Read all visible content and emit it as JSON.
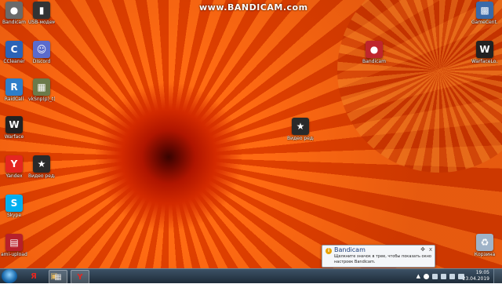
{
  "watermark": "www.BANDICAM.com",
  "desktop_icons": [
    {
      "label": "Bandicam",
      "icon": "bandicam-icon",
      "color": "#6a6a6a",
      "glyph": "●"
    },
    {
      "label": "USB-модем Билайн",
      "icon": "usb-modem-icon",
      "color": "#333333",
      "glyph": "▮"
    },
    {
      "label": "CCleaner",
      "icon": "ccleaner-icon",
      "color": "#2b63b7",
      "glyph": "C"
    },
    {
      "label": "Discord",
      "icon": "discord-icon",
      "color": "#5b6bcd",
      "glyph": "☺"
    },
    {
      "label": "RaidCall",
      "icon": "raidcall-icon",
      "color": "#2e7ec9",
      "glyph": "R"
    },
    {
      "label": "vkSnp(p)_t(c)",
      "icon": "photo-icon",
      "color": "#6c7a4a",
      "glyph": "▦"
    },
    {
      "label": "Warface",
      "icon": "warface-icon",
      "color": "#222222",
      "glyph": "W"
    },
    {
      "label": "Yandex",
      "icon": "yandex-icon",
      "color": "#e52620",
      "glyph": "Y"
    },
    {
      "label": "Видео редакт...",
      "icon": "video-editor-icon",
      "color": "#2a2a2a",
      "glyph": "★"
    },
    {
      "label": "Skype",
      "icon": "skype-icon",
      "color": "#00aff0",
      "glyph": "S"
    },
    {
      "label": "ami-upload...",
      "icon": "file-icon",
      "color": "#b8202a",
      "glyph": "▤"
    },
    {
      "label": "Bandicam",
      "icon": "bandicam-icon",
      "color": "#c0262c",
      "glyph": "●"
    },
    {
      "label": "Видео редакт...",
      "icon": "video-editor-icon",
      "color": "#2a2a2a",
      "glyph": "★"
    },
    {
      "label": "GameCent...",
      "icon": "game-center-icon",
      "color": "#3a6aa8",
      "glyph": "▩"
    },
    {
      "label": "WarfaceLo...",
      "icon": "warface-icon",
      "color": "#222222",
      "glyph": "W"
    },
    {
      "label": "Корзина",
      "icon": "recycle-bin-icon",
      "color": "#9fb3c8",
      "glyph": "♻"
    }
  ],
  "notification": {
    "title": "Bandicam",
    "text": "Щелкните значок в трее, чтобы показать окно настроек Bandicam.",
    "close_label": "x",
    "options_label": "✥"
  },
  "taskbar": {
    "items": [
      {
        "name": "yandex-browser",
        "glyph": "Я",
        "color": "#e52620"
      },
      {
        "name": "file-explorer",
        "glyph": "▣",
        "color": "#d8a640"
      },
      {
        "name": "video-editor",
        "glyph": "▦",
        "color": "#555555"
      },
      {
        "name": "yandex",
        "glyph": "Y",
        "color": "#e52620"
      }
    ],
    "tray_arrow": "▲",
    "clock_time": "19:05",
    "clock_date": "23.04.2019"
  }
}
